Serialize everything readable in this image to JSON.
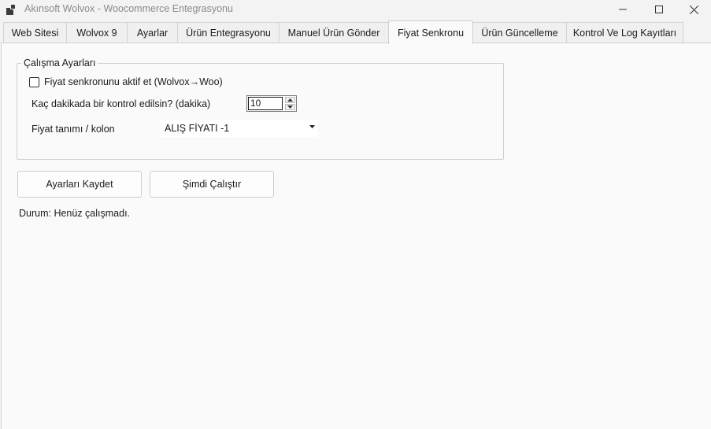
{
  "window": {
    "title": "Akınsoft Wolvox - Woocommerce Entegrasyonu"
  },
  "tabs": [
    {
      "label": "Web Sitesi"
    },
    {
      "label": "Wolvox 9"
    },
    {
      "label": "Ayarlar"
    },
    {
      "label": "Ürün Entegrasyonu"
    },
    {
      "label": "Manuel Ürün Gönder"
    },
    {
      "label": "Fiyat Senkronu",
      "active": true
    },
    {
      "label": "Ürün Güncelleme"
    },
    {
      "label": "Kontrol Ve Log Kayıtları"
    }
  ],
  "settings": {
    "group_title": "Çalışma Ayarları",
    "enable_label": "Fiyat senkronunu aktif et (Wolvox→Woo)",
    "enable_checked": false,
    "interval_label": "Kaç dakikada bir kontrol edilsin? (dakika)",
    "interval_value": "10",
    "price_label": "Fiyat tanımı / kolon",
    "price_value": "ALIŞ FİYATI -1"
  },
  "actions": {
    "save_label": "Ayarları Kaydet",
    "run_label": "Şimdi Çalıştır"
  },
  "status": {
    "text": "Durum: Henüz çalışmadı."
  }
}
